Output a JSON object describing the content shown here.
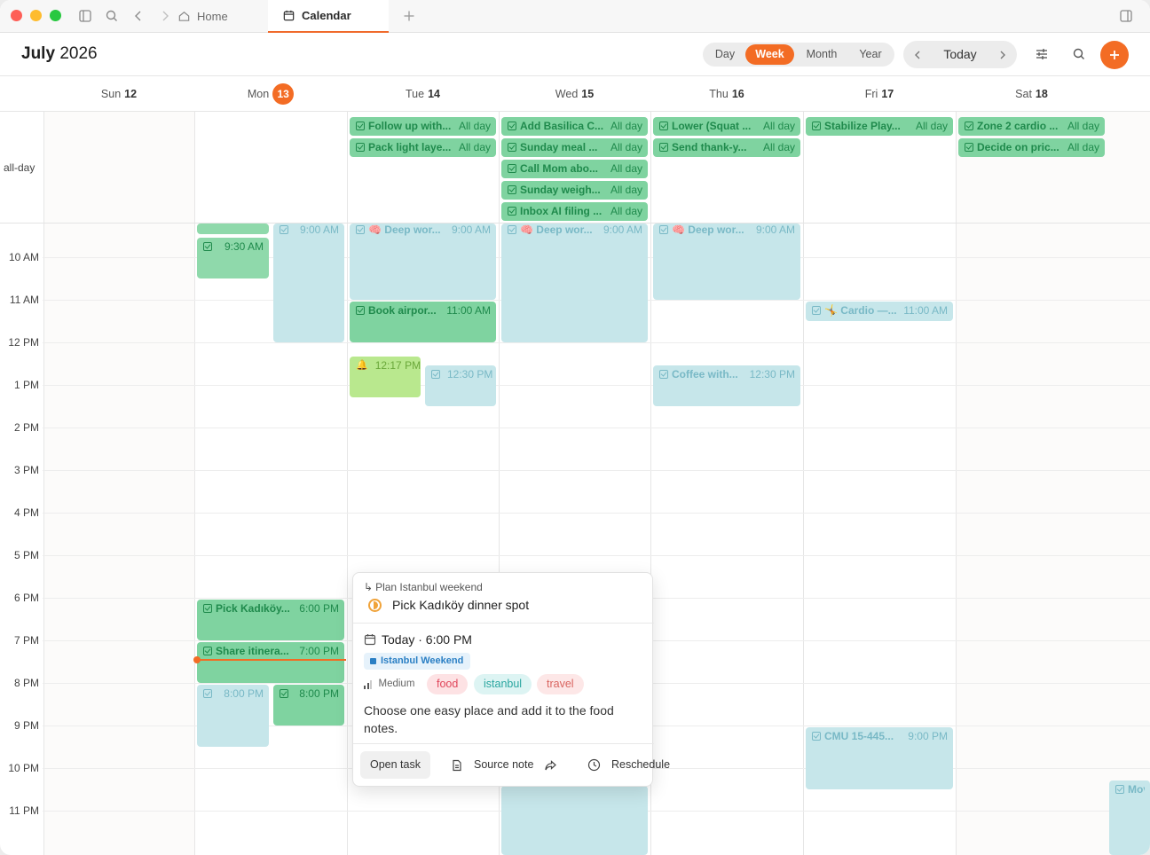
{
  "titlebar": {
    "tabs": [
      {
        "label": "Home"
      },
      {
        "label": "Calendar"
      }
    ]
  },
  "header": {
    "month": "July",
    "year": "2026",
    "views": [
      "Day",
      "Week",
      "Month",
      "Year"
    ],
    "active_view": "Week",
    "today_label": "Today"
  },
  "days": [
    {
      "dow": "Sun",
      "date": "12"
    },
    {
      "dow": "Mon",
      "date": "13",
      "today": true
    },
    {
      "dow": "Tue",
      "date": "14"
    },
    {
      "dow": "Wed",
      "date": "15"
    },
    {
      "dow": "Thu",
      "date": "16"
    },
    {
      "dow": "Fri",
      "date": "17"
    },
    {
      "dow": "Sat",
      "date": "18"
    }
  ],
  "allday_label": "all-day",
  "hours": [
    "10 AM",
    "11 AM",
    "12 PM",
    "1 PM",
    "2 PM",
    "3 PM",
    "4 PM",
    "5 PM",
    "6 PM",
    "7 PM",
    "8 PM",
    "9 PM",
    "10 PM",
    "11 PM"
  ],
  "allday_events": [
    {
      "title": "Follow up with...",
      "time": "All day"
    },
    {
      "title": "Pack light laye...",
      "time": "All day"
    },
    {
      "title": "Add Basilica C...",
      "time": "All day"
    },
    {
      "title": "Sunday meal ...",
      "time": "All day"
    },
    {
      "title": "Call Mom abo...",
      "time": "All day"
    },
    {
      "title": "Sunday weigh...",
      "time": "All day"
    },
    {
      "title": "Inbox AI filing ...",
      "time": "All day"
    },
    {
      "title": "Lower (Squat ...",
      "time": "All day"
    },
    {
      "title": "Send thank-y...",
      "time": "All day"
    },
    {
      "title": "Stabilize Play...",
      "time": "All day"
    },
    {
      "title": "Zone 2 cardio ...",
      "time": "All day"
    },
    {
      "title": "Decide on pric...",
      "time": "All day"
    }
  ],
  "timed_events": [
    {
      "title": "",
      "time": "9:30 AM"
    },
    {
      "title": "",
      "time": "9:00 AM"
    },
    {
      "title": "🧠 Deep wor...",
      "time": "9:00 AM"
    },
    {
      "title": "🧠 Deep wor...",
      "time": "9:00 AM"
    },
    {
      "title": "🧠 Deep wor...",
      "time": "9:00 AM"
    },
    {
      "title": "Book airpor...",
      "time": "11:00 AM"
    },
    {
      "title": "🤸 Cardio —...",
      "time": "11:00 AM"
    },
    {
      "title": "",
      "time": "12:17 PM"
    },
    {
      "title": "",
      "time": "12:30 PM"
    },
    {
      "title": "Coffee with...",
      "time": "12:30 PM"
    },
    {
      "title": "Pick Kadıköy...",
      "time": "6:00 PM"
    },
    {
      "title": "Share itinera...",
      "time": "7:00 PM"
    },
    {
      "title": "",
      "time": "8:00 PM"
    },
    {
      "title": "",
      "time": "8:00 PM"
    },
    {
      "title": "CMU 15-445...",
      "time": "9:00 PM"
    },
    {
      "title": "Mov",
      "time": ""
    }
  ],
  "popover": {
    "parent": "Plan Istanbul weekend",
    "title": "Pick Kadıköy dinner spot",
    "when": "Today · 6:00 PM",
    "project": "Istanbul Weekend",
    "priority": "Medium",
    "tags": [
      {
        "label": "food",
        "bg": "#fde2e4",
        "fg": "#e0455a"
      },
      {
        "label": "istanbul",
        "bg": "#ddf4f3",
        "fg": "#2aa6a0"
      },
      {
        "label": "travel",
        "bg": "#fde7e7",
        "fg": "#d9645f"
      }
    ],
    "description": "Choose one easy place and add it to the food notes.",
    "buttons": {
      "open": "Open task",
      "source": "Source note",
      "reschedule": "Reschedule"
    }
  },
  "colors": {
    "accent": "#f36c24",
    "task_green": "#7fd3a0",
    "event_blue": "#c6e6ea",
    "reminder_lime": "#b9e88e"
  }
}
